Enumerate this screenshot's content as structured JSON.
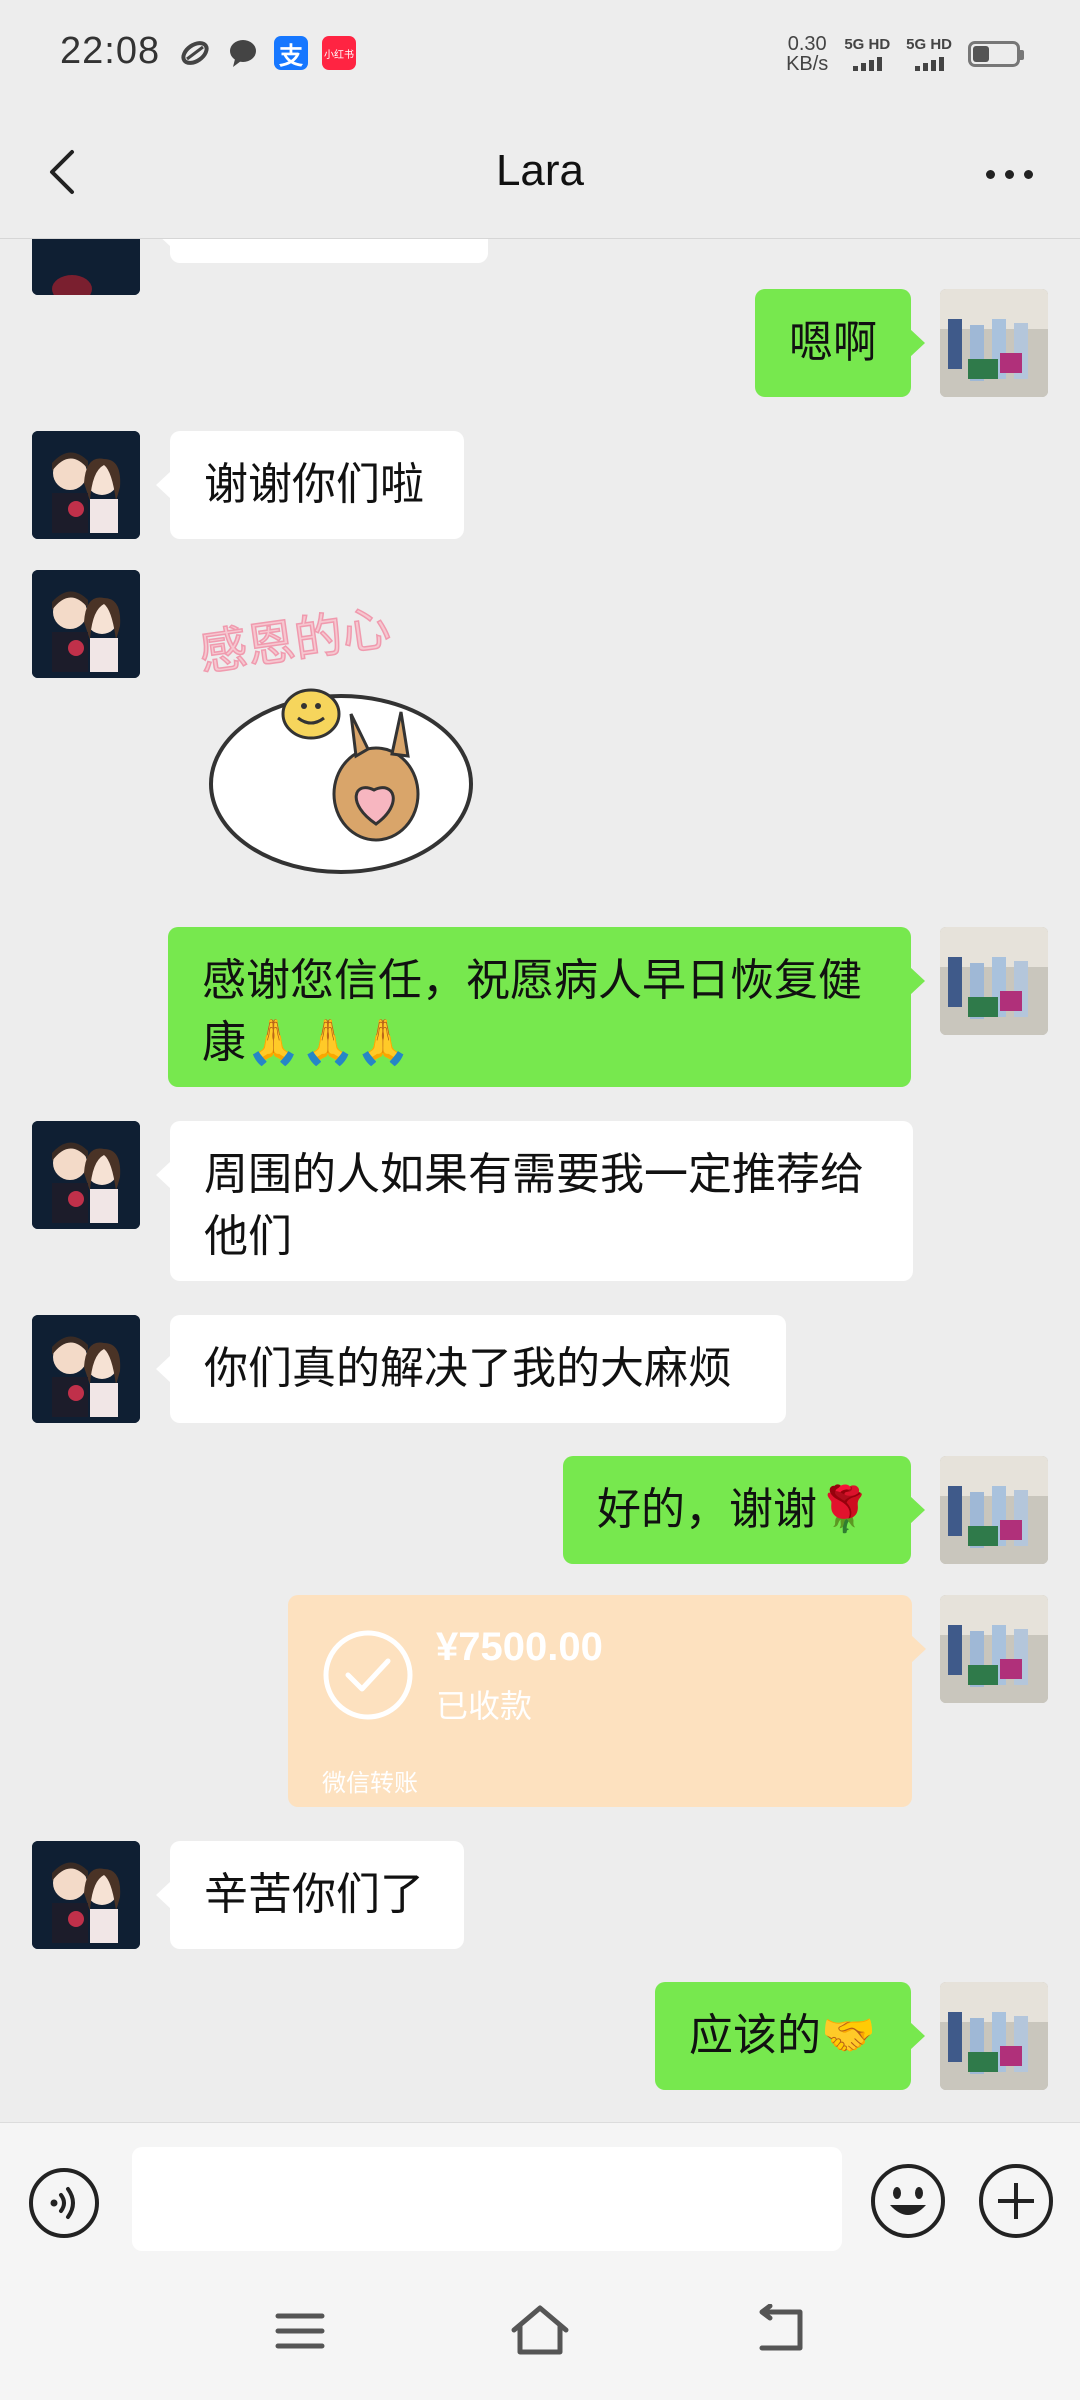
{
  "status_bar": {
    "time": "22:08",
    "net_speed_value": "0.30",
    "net_speed_unit": "KB/s",
    "sim1": "5G HD",
    "sim2": "5G HD",
    "icons": [
      "link-icon",
      "chat-bubble-icon",
      "alipay-icon",
      "xiaohongshu-icon"
    ],
    "alipay_glyph": "支",
    "xiaohongshu_glyph": "小红书"
  },
  "nav": {
    "title": "Lara",
    "back_icon": "back-arrow-icon",
    "more_icon": "more-icon"
  },
  "messages": [
    {
      "id": "m1",
      "side": "out",
      "text": "嗯啊"
    },
    {
      "id": "m2",
      "side": "in",
      "text": "谢谢你们啦"
    },
    {
      "id": "m3",
      "side": "in",
      "type": "sticker",
      "sticker_text": "感恩的心"
    },
    {
      "id": "m4",
      "side": "out",
      "text": "感谢您信任，祝愿病人早日恢复健康🙏🙏🙏"
    },
    {
      "id": "m5",
      "side": "in",
      "text": "周围的人如果有需要我一定推荐给他们"
    },
    {
      "id": "m6",
      "side": "in",
      "text": "你们真的解决了我的大麻烦"
    },
    {
      "id": "m7",
      "side": "out",
      "text": "好的，谢谢🌹"
    },
    {
      "id": "m8",
      "side": "out",
      "type": "transfer",
      "amount": "¥7500.00",
      "status": "已收款",
      "footer": "微信转账"
    },
    {
      "id": "m9",
      "side": "in",
      "text": "辛苦你们了"
    },
    {
      "id": "m10",
      "side": "out",
      "text": "应该的🤝"
    }
  ],
  "input_bar": {
    "placeholder": "",
    "voice_icon": "voice-icon",
    "emoji_icon": "emoji-icon",
    "plus_icon": "plus-icon"
  },
  "colors": {
    "background": "#ededed",
    "outgoing_bubble": "#77e84e",
    "incoming_bubble": "#ffffff",
    "transfer_card": "#fde1bf"
  }
}
